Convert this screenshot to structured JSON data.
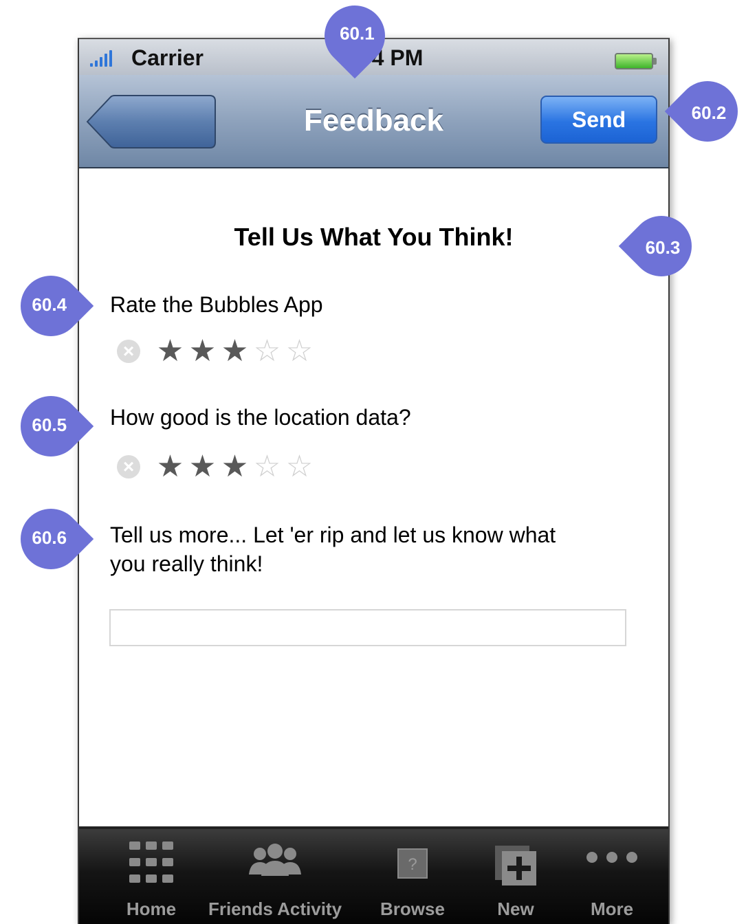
{
  "status_bar": {
    "carrier": "Carrier",
    "time": "4 PM"
  },
  "nav": {
    "title": "Feedback",
    "send_label": "Send",
    "back_label": ""
  },
  "content": {
    "heading": "Tell Us What You Think!",
    "question1": {
      "label": "Rate the Bubbles App",
      "rating": 3,
      "max": 5
    },
    "question2": {
      "label": "How good is the location data?",
      "rating": 3,
      "max": 5
    },
    "comment": {
      "label_line1": "Tell us more... Let 'er rip and let us know what",
      "label_line2": "you really think!",
      "value": ""
    }
  },
  "tabs": [
    {
      "label": "Home",
      "icon": "grid-icon"
    },
    {
      "label": "Friends Activity",
      "icon": "people-icon"
    },
    {
      "label": "Browse",
      "icon": "question-box-icon"
    },
    {
      "label": "New",
      "icon": "plus-document-icon"
    },
    {
      "label": "More",
      "icon": "ellipsis-icon"
    }
  ],
  "callouts": [
    "60.1",
    "60.2",
    "60.3",
    "60.4",
    "60.5",
    "60.6"
  ]
}
